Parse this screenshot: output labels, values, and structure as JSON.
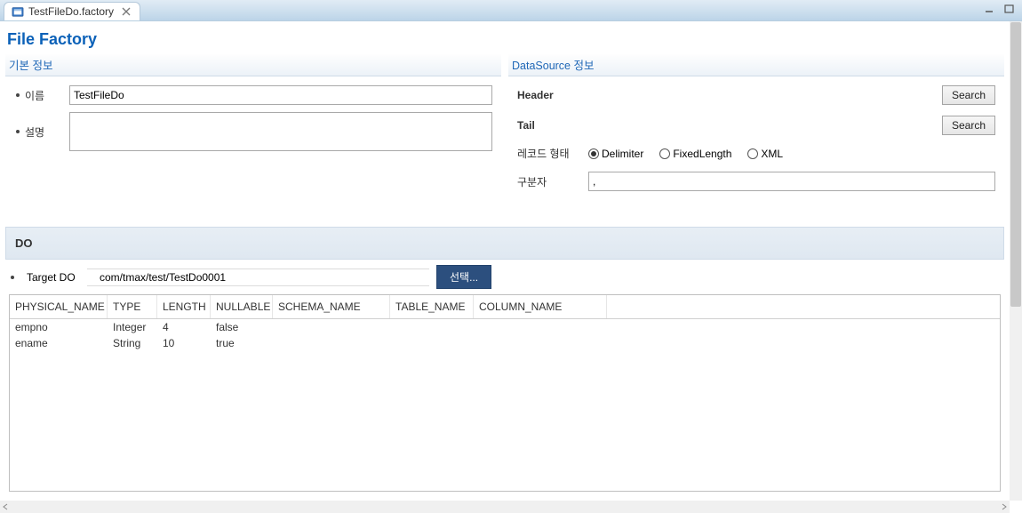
{
  "tab": {
    "title": "TestFileDo.factory"
  },
  "page": {
    "title": "File Factory"
  },
  "basic": {
    "header": "기본 정보",
    "name_label": "이름",
    "name_value": "TestFileDo",
    "desc_label": "설명",
    "desc_value": ""
  },
  "datasource": {
    "header": "DataSource 정보",
    "header_label": "Header",
    "tail_label": "Tail",
    "search_btn": "Search",
    "record_type_label": "레코드 형태",
    "record_type_options": [
      "Delimiter",
      "FixedLength",
      "XML"
    ],
    "record_type_selected": "Delimiter",
    "delimiter_label": "구분자",
    "delimiter_value": ","
  },
  "do": {
    "section_label": "DO",
    "target_label": "Target DO",
    "target_value": "com/tmax/test/TestDo0001",
    "select_btn": "선택...",
    "columns": [
      "PHYSICAL_NAME",
      "TYPE",
      "LENGTH",
      "NULLABLE",
      "SCHEMA_NAME",
      "TABLE_NAME",
      "COLUMN_NAME"
    ],
    "rows": [
      {
        "physical_name": "empno",
        "type": "Integer",
        "length": "4",
        "nullable": "false",
        "schema_name": "",
        "table_name": "",
        "column_name": ""
      },
      {
        "physical_name": "ename",
        "type": "String",
        "length": "10",
        "nullable": "true",
        "schema_name": "",
        "table_name": "",
        "column_name": ""
      }
    ]
  }
}
